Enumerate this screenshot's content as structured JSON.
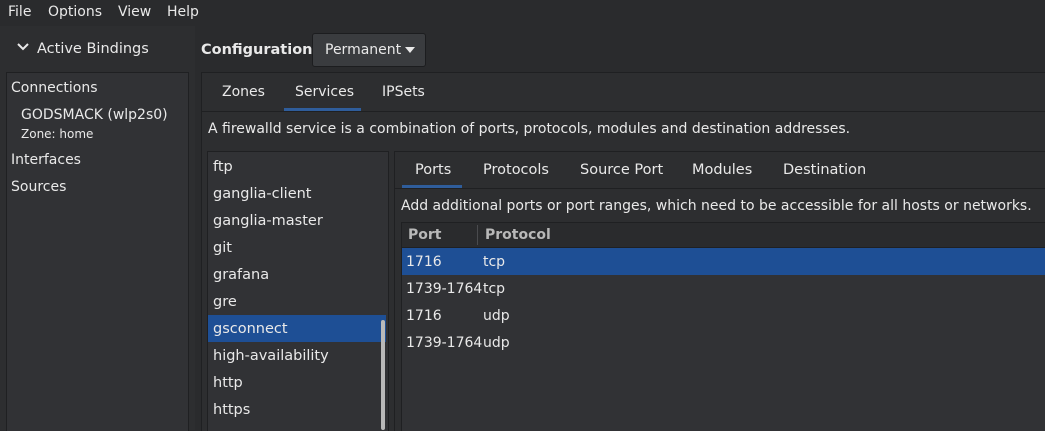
{
  "menubar": {
    "items": [
      "File",
      "Options",
      "View",
      "Help"
    ]
  },
  "bindings": {
    "header": "Active Bindings",
    "connections_label": "Connections",
    "connection_name": "GODSMACK (wlp2s0)",
    "connection_zone": "Zone: home",
    "interfaces_label": "Interfaces",
    "sources_label": "Sources"
  },
  "configuration": {
    "label": "Configuration:",
    "value": "Permanent"
  },
  "top_tabs": {
    "items": [
      "Zones",
      "Services",
      "IPSets"
    ],
    "active": "Services"
  },
  "services": {
    "description": "A firewalld service is a combination of ports, protocols, modules and destination addresses.",
    "list": [
      "ftp",
      "ganglia-client",
      "ganglia-master",
      "git",
      "grafana",
      "gre",
      "gsconnect",
      "high-availability",
      "http",
      "https"
    ],
    "selected": "gsconnect"
  },
  "inner_tabs": {
    "items": [
      "Ports",
      "Protocols",
      "Source Port",
      "Modules",
      "Destination"
    ],
    "active": "Ports"
  },
  "ports": {
    "description": "Add additional ports or port ranges, which need to be accessible for all hosts or networks.",
    "columns": [
      "Port",
      "Protocol"
    ],
    "rows": [
      {
        "port": "1716",
        "protocol": "tcp"
      },
      {
        "port": "1739-1764",
        "protocol": "tcp"
      },
      {
        "port": "1716",
        "protocol": "udp"
      },
      {
        "port": "1739-1764",
        "protocol": "udp"
      }
    ],
    "selected_row": 0
  },
  "icons": {
    "collapse": "chevron-down-icon",
    "dropdown": "triangle-down-icon"
  },
  "colors": {
    "selection": "#1e4f95",
    "tab_underline": "#2f5d9b",
    "background": "#2a2b2d"
  }
}
